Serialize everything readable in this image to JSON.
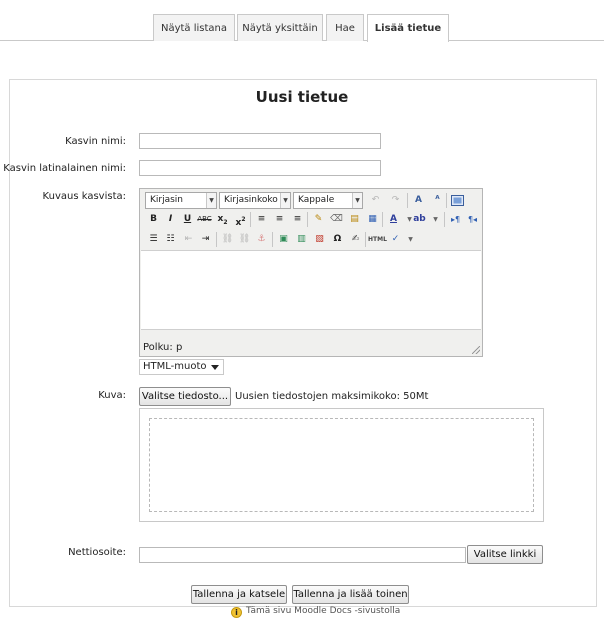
{
  "tabs": [
    {
      "label": "Näytä listana",
      "active": false
    },
    {
      "label": "Näytä yksittäin",
      "active": false
    },
    {
      "label": "Hae",
      "active": false
    },
    {
      "label": "Lisää tietue",
      "active": true
    }
  ],
  "form": {
    "title": "Uusi tietue",
    "fields": {
      "name_label": "Kasvin nimi:",
      "name_value": "",
      "latin_label": "Kasvin latinalainen nimi:",
      "latin_value": "",
      "description_label": "Kuvaus kasvista:",
      "image_label": "Kuva:",
      "url_label": "Nettiosoite:",
      "url_value": ""
    }
  },
  "editor": {
    "font_family": "Kirjasin",
    "font_size": "Kirjasinkoko",
    "block_format": "Kappale",
    "path": "Polku: p",
    "content": "",
    "format_option": "HTML-muoto",
    "toolbar_icons": {
      "row1": [
        "undo-icon",
        "redo-icon",
        "find-icon",
        "replace-icon",
        "fullscreen-icon"
      ],
      "row2": [
        "bold-icon",
        "italic-icon",
        "underline-icon",
        "strikethrough-icon",
        "subscript-icon",
        "superscript-icon",
        "align-left-icon",
        "align-center-icon",
        "align-right-icon",
        "clean-icon",
        "remove-format-icon",
        "paste-text-icon",
        "paste-word-icon",
        "text-color-icon",
        "highlight-color-icon",
        "ltr-icon",
        "rtl-icon"
      ],
      "row3": [
        "bullet-list-icon",
        "numbered-list-icon",
        "outdent-icon",
        "indent-icon",
        "link-icon",
        "unlink-icon",
        "anchor-icon",
        "image-icon",
        "media-icon",
        "cleanup-icon",
        "special-char-icon",
        "edit-icon",
        "html-icon",
        "spellcheck-icon"
      ]
    }
  },
  "file": {
    "choose_button": "Valitse tiedosto...",
    "max_size_text": "Uusien tiedostojen maksimikoko: 50Mt"
  },
  "url": {
    "choose_link_button": "Valitse linkki"
  },
  "actions": {
    "save_view": "Tallenna ja katsele",
    "save_add": "Tallenna ja lisää toinen"
  },
  "footer": {
    "docs_link": "Tämä sivu Moodle Docs -sivustolla"
  }
}
